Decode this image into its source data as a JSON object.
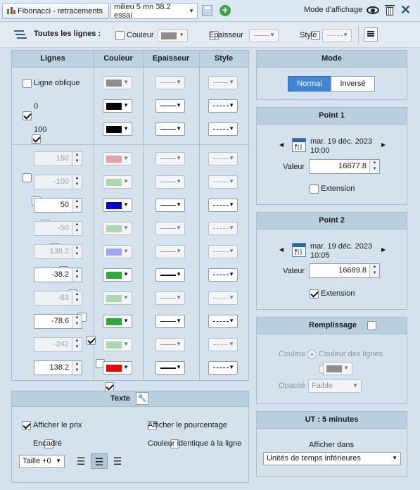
{
  "title_bar": {
    "tab_label": "Fibonacci - retracements",
    "instance_label": "milieu 5 mn 38.2 essai",
    "display_mode_label": "Mode d'affichage"
  },
  "toolbar": {
    "all_lines_label": "Toutes les lignes :",
    "color_label": "Couleur",
    "thickness_label": "Epaisseur",
    "style_label": "Style"
  },
  "lines_table": {
    "headers": [
      "Lignes",
      "Couleur",
      "Epaisseur",
      "Style"
    ],
    "oblique_label": "Ligne oblique",
    "fixed_rows": [
      {
        "label": "0",
        "checked": true,
        "color": "#000000"
      },
      {
        "label": "100",
        "checked": true,
        "color": "#000000"
      }
    ],
    "levels": [
      {
        "value": "150",
        "checked": false,
        "color": "#e0a0a6"
      },
      {
        "value": "-100",
        "checked": false,
        "color": "#a8d8ac"
      },
      {
        "value": "50",
        "checked": true,
        "color": "#0000dd"
      },
      {
        "value": "-50",
        "checked": false,
        "color": "#a8d8ac"
      },
      {
        "value": "138.2",
        "checked": false,
        "color": "#a0a4f0"
      },
      {
        "value": "-38.2",
        "checked": true,
        "color": "#2ea83a"
      },
      {
        "value": "-63",
        "checked": false,
        "color": "#a8d8ac"
      },
      {
        "value": "-78.6",
        "checked": true,
        "color": "#2ea83a"
      },
      {
        "value": "-242",
        "checked": false,
        "color": "#a8d8ac"
      },
      {
        "value": "138.2",
        "checked": true,
        "color": "#ee0000"
      }
    ]
  },
  "mode": {
    "title": "Mode",
    "normal_label": "Normal",
    "inverse_label": "Inversé"
  },
  "point1": {
    "title": "Point 1",
    "date": "mar. 19 déc. 2023",
    "time": "10:00",
    "value_label": "Valeur",
    "value": "16677.8",
    "extension_label": "Extension",
    "extension_checked": false
  },
  "point2": {
    "title": "Point 2",
    "date": "mar. 19 déc. 2023",
    "time": "10:05",
    "value_label": "Valeur",
    "value": "16689.8",
    "extension_label": "Extension",
    "extension_checked": true
  },
  "fill": {
    "title": "Remplissage",
    "color_label": "Couleur",
    "line_color_option": "Couleur des lignes",
    "opacity_label": "Opacité",
    "opacity_value": "Faible"
  },
  "text_section": {
    "title": "Texte",
    "show_price": "Afficher le prix",
    "show_percentage": "Afficher le pourcentage",
    "framed": "Encadré",
    "same_color": "Couleur identique à la ligne",
    "size_value": "Taille +0"
  },
  "timeframe": {
    "title": "UT : 5 minutes",
    "display_in_label": "Afficher dans",
    "display_in_value": "Unités de temps inférieures"
  },
  "colors": {
    "accent": "#3f86d6",
    "panel_header": "#b9cfde",
    "panel_bg": "#d3e2ec"
  }
}
